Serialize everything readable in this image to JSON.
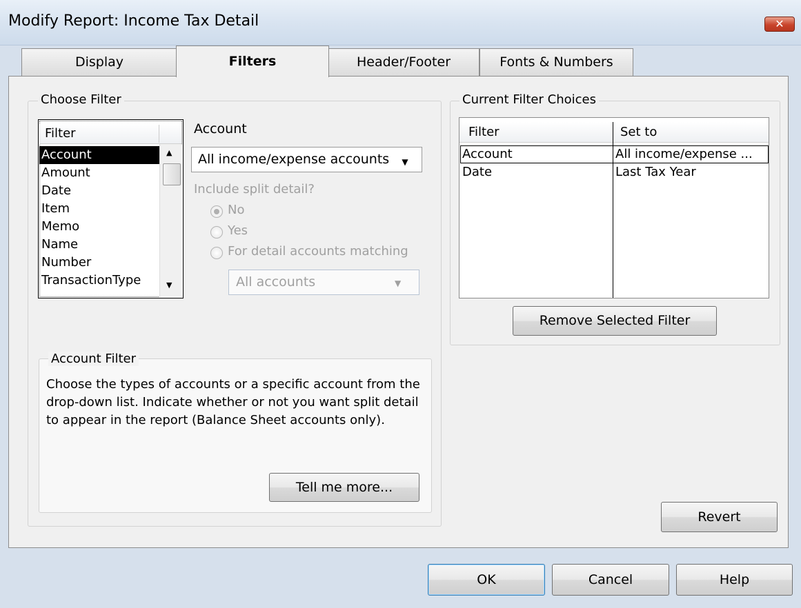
{
  "window": {
    "title": "Modify Report: Income Tax Detail",
    "close_glyph": "✕"
  },
  "tabs": [
    {
      "label": "Display",
      "selected": false
    },
    {
      "label": "Filters",
      "selected": true
    },
    {
      "label": "Header/Footer",
      "selected": false
    },
    {
      "label": "Fonts & Numbers",
      "selected": false
    }
  ],
  "choose_filter": {
    "group_label": "Choose Filter",
    "list_header": "Filter",
    "items": [
      "Account",
      "Amount",
      "Date",
      "Item",
      "Memo",
      "Name",
      "Number",
      "TransactionType"
    ],
    "selected_item": "Account"
  },
  "account_options": {
    "label": "Account",
    "dropdown_value": "All income/expense accounts",
    "split_detail_label": "Include split detail?",
    "radio_no": "No",
    "radio_yes": "Yes",
    "radio_matching": "For detail accounts matching",
    "radio_selected": "No",
    "matching_dropdown_value": "All accounts"
  },
  "account_filter": {
    "group_label": "Account Filter",
    "description": "Choose the types of accounts or a specific account from the drop-down list. Indicate whether or not you want split detail to appear in the report (Balance Sheet accounts only).",
    "tell_me_more_label": "Tell me more..."
  },
  "current_filters": {
    "group_label": "Current Filter Choices",
    "columns": [
      "Filter",
      "Set to"
    ],
    "rows": [
      {
        "filter": "Account",
        "set_to": "All income/expense ...",
        "selected": true
      },
      {
        "filter": "Date",
        "set_to": "Last Tax Year",
        "selected": false
      }
    ],
    "remove_button_label": "Remove Selected Filter"
  },
  "buttons": {
    "revert": "Revert",
    "ok": "OK",
    "cancel": "Cancel",
    "help": "Help"
  }
}
